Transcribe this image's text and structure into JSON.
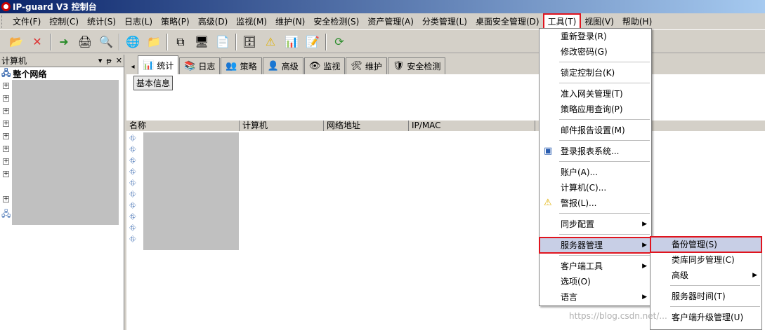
{
  "window": {
    "title": "IP-guard V3 控制台"
  },
  "menubar": {
    "items": [
      "文件(F)",
      "控制(C)",
      "统计(S)",
      "日志(L)",
      "策略(P)",
      "高级(D)",
      "监视(M)",
      "维护(N)",
      "安全检测(S)",
      "资产管理(A)",
      "分类管理(L)",
      "桌面安全管理(D)",
      "工具(T)",
      "视图(V)",
      "帮助(H)"
    ],
    "active": "工具(T)"
  },
  "left_pane": {
    "title": "计算机",
    "controls": [
      "▾",
      "ᵽ",
      "✕"
    ],
    "root_label": "整个网络"
  },
  "tabs": [
    {
      "label": "统计",
      "icon": "chart-icon"
    },
    {
      "label": "日志",
      "icon": "log-icon"
    },
    {
      "label": "策略",
      "icon": "policy-icon"
    },
    {
      "label": "高级",
      "icon": "advanced-icon"
    },
    {
      "label": "监视",
      "icon": "monitor-icon"
    },
    {
      "label": "维护",
      "icon": "maintain-icon"
    },
    {
      "label": "安全检测",
      "icon": "security-icon"
    }
  ],
  "sub_button": "基本信息",
  "table": {
    "columns": [
      "名称",
      "计算机",
      "网络地址",
      "IP/MAC"
    ]
  },
  "tools_menu": {
    "items": [
      {
        "label": "重新登录(R)"
      },
      {
        "label": "修改密码(G)"
      },
      {
        "sep": true
      },
      {
        "label": "锁定控制台(K)"
      },
      {
        "sep": true
      },
      {
        "label": "准入网关管理(T)"
      },
      {
        "label": "策略应用查询(P)"
      },
      {
        "sep": true
      },
      {
        "label": "邮件报告设置(M)"
      },
      {
        "sep": true
      },
      {
        "label": "登录报表系统...",
        "icon": "report-icon"
      },
      {
        "sep": true
      },
      {
        "label": "账户(A)..."
      },
      {
        "label": "计算机(C)..."
      },
      {
        "label": "警报(L)...",
        "icon": "warning-icon"
      },
      {
        "sep": true
      },
      {
        "label": "同步配置",
        "submenu": true
      },
      {
        "sep": true
      },
      {
        "label": "服务器管理",
        "submenu": true,
        "highlighted": true
      },
      {
        "sep": true
      },
      {
        "label": "客户端工具",
        "submenu": true
      },
      {
        "label": "选项(O)"
      },
      {
        "label": "语言",
        "submenu": true
      }
    ]
  },
  "server_submenu": {
    "items": [
      {
        "label": "备份管理(S)",
        "highlighted": true
      },
      {
        "label": "类库同步管理(C)"
      },
      {
        "label": "高级",
        "submenu": true
      },
      {
        "sep": true
      },
      {
        "label": "服务器时间(T)"
      },
      {
        "sep": true
      },
      {
        "label": "客户端升级管理(U)"
      }
    ]
  },
  "watermark": "https://blog.csdn.net/..."
}
